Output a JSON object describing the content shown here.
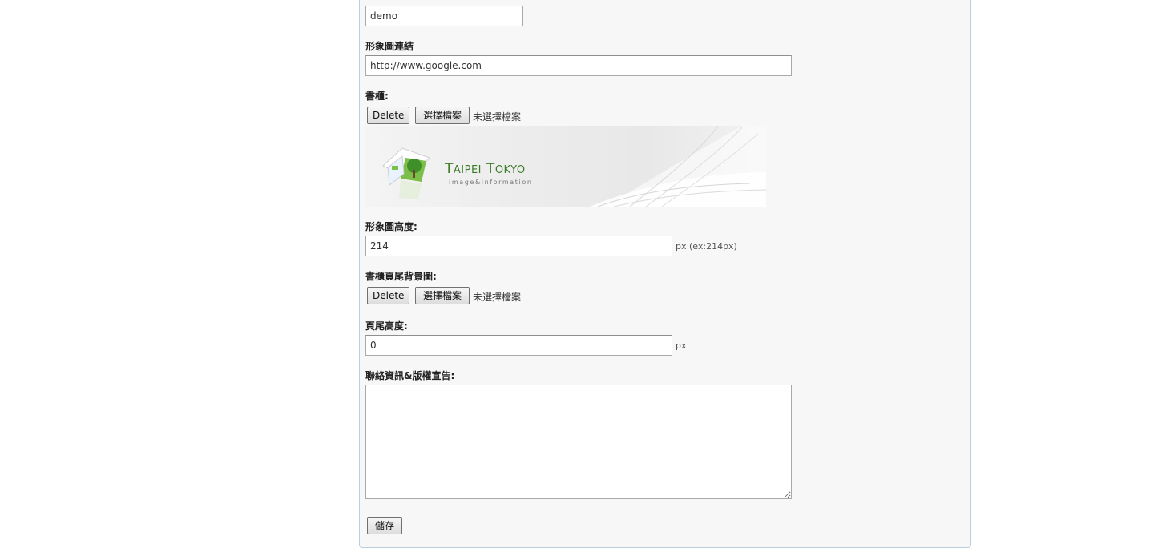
{
  "fields": {
    "username_value": "demo",
    "banner_link_label": "形象圖連結",
    "banner_link_value": "http://www.google.com",
    "banner_label": "書櫃:",
    "banner_height_label": "形象圖高度:",
    "banner_height_value": "214",
    "banner_height_hint": "px (ex:214px)",
    "footer_bg_label": "書櫃頁尾背景圖:",
    "footer_height_label": "頁尾高度:",
    "footer_height_value": "0",
    "footer_height_unit": "px",
    "contact_label": "聯絡資訊&版權宣告:",
    "contact_value": ""
  },
  "file_controls": {
    "delete_label": "Delete",
    "choose_label": "選擇檔案",
    "status_label": "未選擇檔案"
  },
  "banner_image": {
    "brand": "TAIPEI TOKYO",
    "brand_part1_initial": "T",
    "brand_part1_rest": "AIPEI",
    "brand_part2_initial": "T",
    "brand_part2_rest": "OKYO",
    "tagline": "image&information",
    "accent_color": "#3d7a2a"
  },
  "actions": {
    "save_label": "儲存"
  }
}
